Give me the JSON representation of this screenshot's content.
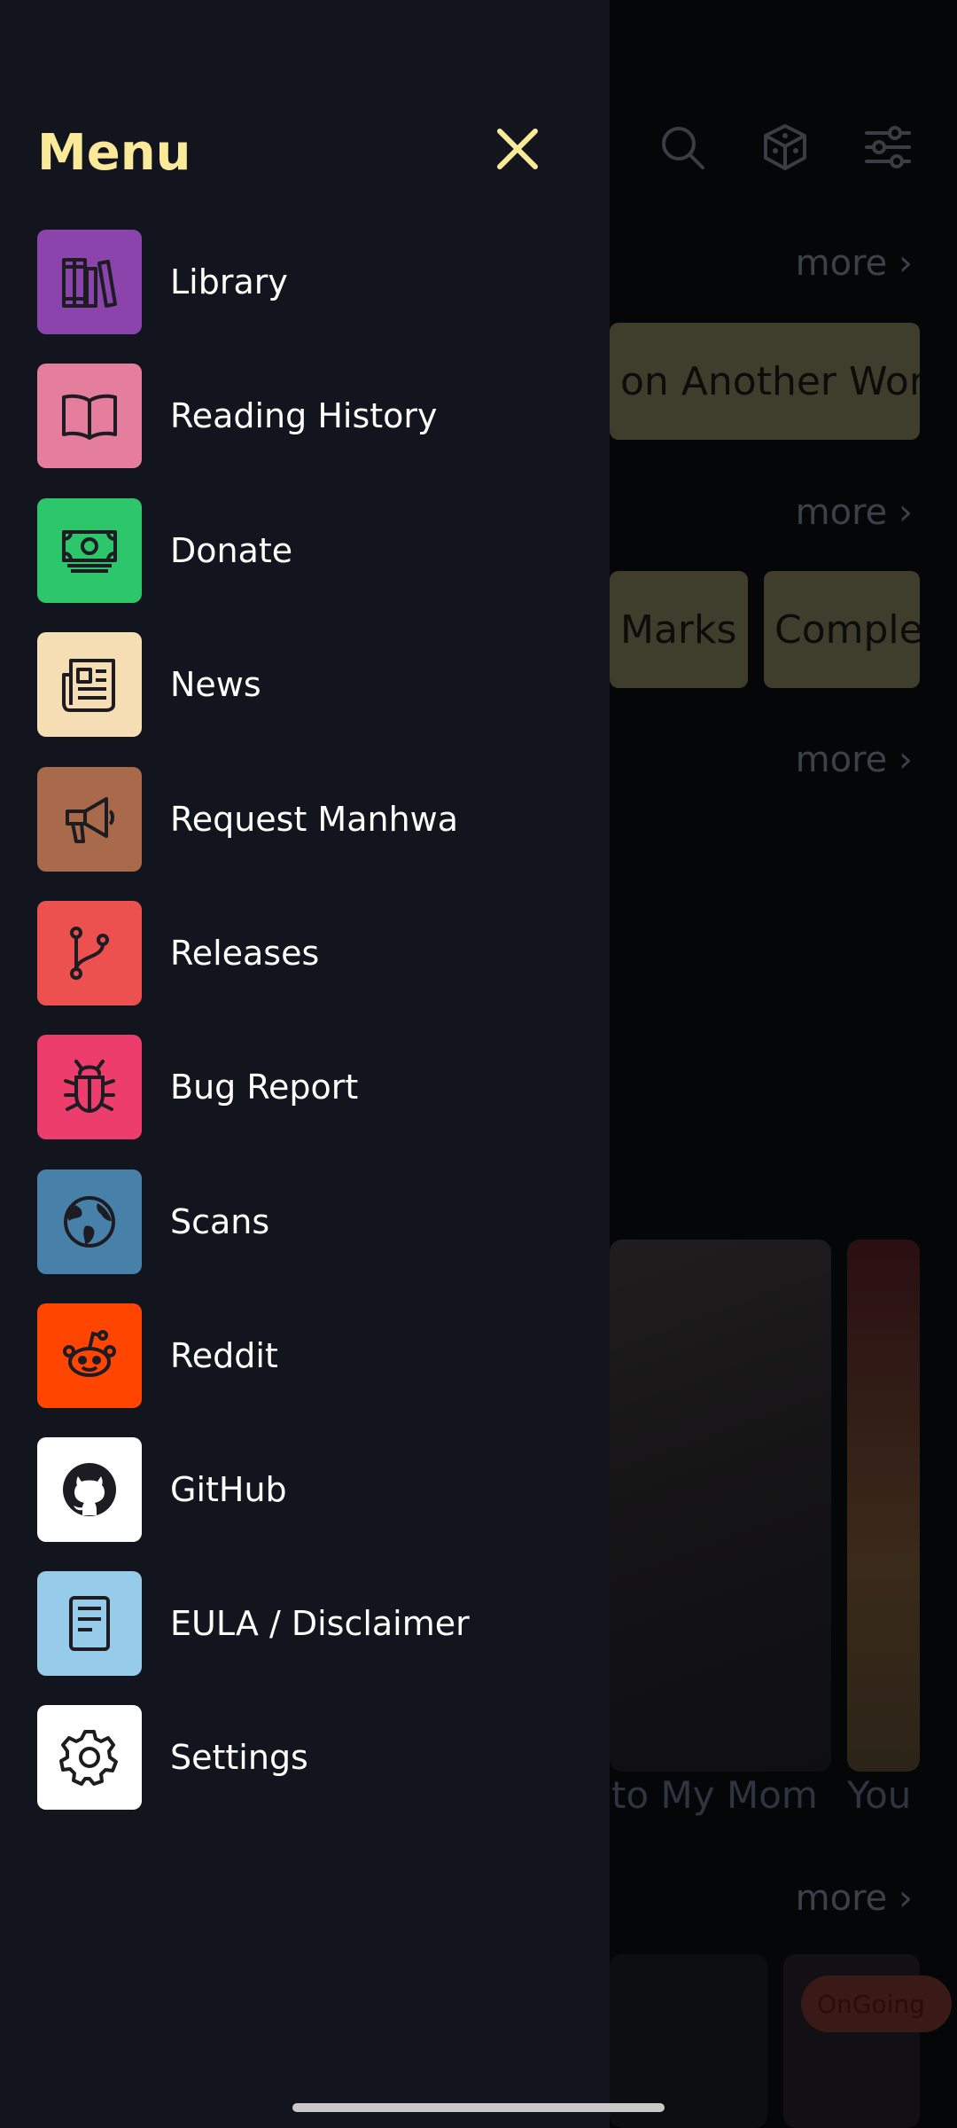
{
  "background": {
    "more_label": "more",
    "chips_row1": [
      "on Another Work"
    ],
    "chips_row2": [
      "Marks",
      "Comple"
    ],
    "card_titles": [
      "to My Mom",
      "You"
    ],
    "badge": "OnGoing"
  },
  "drawer": {
    "title": "Menu",
    "close_icon": "close-icon",
    "items": [
      {
        "label": "Library",
        "icon": "books-icon",
        "color": "#8b44ac"
      },
      {
        "label": "Reading History",
        "icon": "open-book-icon",
        "color": "#e57e9c"
      },
      {
        "label": "Donate",
        "icon": "money-icon",
        "color": "#2ec66a"
      },
      {
        "label": "News",
        "icon": "newspaper-icon",
        "color": "#f5deb3"
      },
      {
        "label": "Request Manhwa",
        "icon": "megaphone-icon",
        "color": "#a86a4a"
      },
      {
        "label": "Releases",
        "icon": "git-branch-icon",
        "color": "#ec5150"
      },
      {
        "label": "Bug Report",
        "icon": "bug-icon",
        "color": "#ec3d6c"
      },
      {
        "label": "Scans",
        "icon": "globe-icon",
        "color": "#4781a9"
      },
      {
        "label": "Reddit",
        "icon": "reddit-icon",
        "color": "#ff4500"
      },
      {
        "label": "GitHub",
        "icon": "github-icon",
        "color": "#ffffff"
      },
      {
        "label": "EULA / Disclaimer",
        "icon": "document-icon",
        "color": "#96cbea"
      },
      {
        "label": "Settings",
        "icon": "gear-icon",
        "color": "#ffffff"
      }
    ]
  }
}
